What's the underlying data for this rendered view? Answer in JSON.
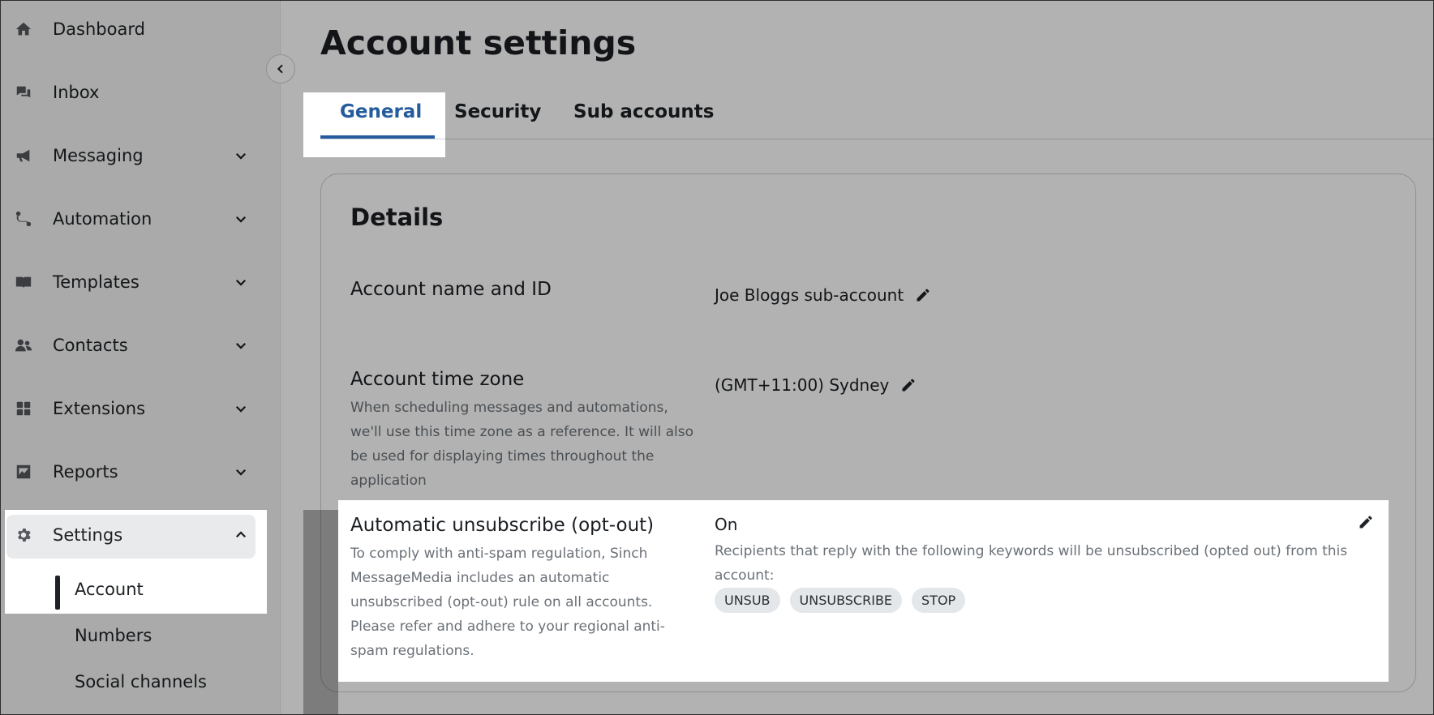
{
  "sidebar": {
    "items": [
      {
        "label": "Dashboard",
        "icon": "home-icon",
        "has_chevron": false
      },
      {
        "label": "Inbox",
        "icon": "chat-icon",
        "has_chevron": false
      },
      {
        "label": "Messaging",
        "icon": "megaphone-icon",
        "has_chevron": true
      },
      {
        "label": "Automation",
        "icon": "route-icon",
        "has_chevron": true
      },
      {
        "label": "Templates",
        "icon": "book-icon",
        "has_chevron": true
      },
      {
        "label": "Contacts",
        "icon": "people-icon",
        "has_chevron": true
      },
      {
        "label": "Extensions",
        "icon": "grid-icon",
        "has_chevron": true
      },
      {
        "label": "Reports",
        "icon": "chart-icon",
        "has_chevron": true
      },
      {
        "label": "Settings",
        "icon": "gear-icon",
        "has_chevron": true,
        "expanded": true
      }
    ],
    "settings_sub": [
      {
        "label": "Account",
        "active": true
      },
      {
        "label": "Numbers"
      },
      {
        "label": "Social channels"
      }
    ]
  },
  "page": {
    "title": "Account settings"
  },
  "tabs": [
    {
      "label": "General",
      "active": true
    },
    {
      "label": "Security"
    },
    {
      "label": "Sub accounts"
    }
  ],
  "details": {
    "title": "Details",
    "account_name": {
      "label": "Account name and ID",
      "value": "Joe Bloggs sub-account"
    },
    "time_zone": {
      "label": "Account time zone",
      "description": "When scheduling messages and automations, we'll use this time zone as a reference. It will also be used for displaying times throughout the application",
      "value": "(GMT+11:00) Sydney"
    },
    "opt_out": {
      "label": "Automatic unsubscribe (opt-out)",
      "description": "To comply with anti-spam regulation, Sinch MessageMedia includes an automatic unsubscribed (opt-out) rule on all accounts. Please refer and adhere to your regional anti-spam regulations.",
      "status": "On",
      "keywords_note": "Recipients that reply with the following keywords will be unsubscribed (opted out) from this account:",
      "keywords": [
        "UNSUB",
        "UNSUBSCRIBE",
        "STOP"
      ]
    }
  },
  "colors": {
    "accent": "#245c9e",
    "text": "#1a1d21",
    "muted": "#6b7178"
  }
}
